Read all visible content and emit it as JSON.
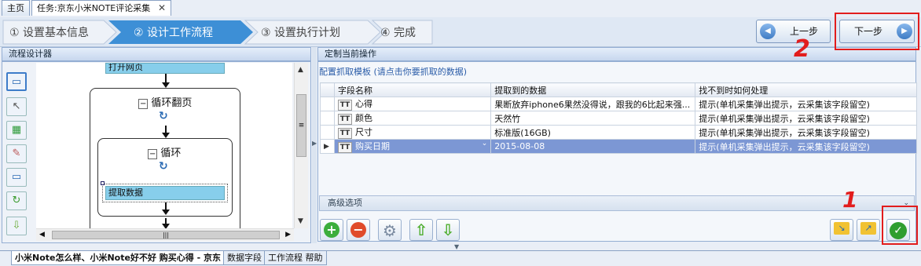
{
  "doc_tabs": [
    "主页",
    "任务:京东小米NOTE评论采集"
  ],
  "wizard": {
    "steps": [
      "① 设置基本信息",
      "② 设计工作流程",
      "③ 设置执行计划",
      "④ 完成"
    ],
    "prev_label": "上一步",
    "next_label": "下一步"
  },
  "left_panel": {
    "title": "流程设计器",
    "nodes": {
      "open_page": "打开网页",
      "loop_page": "循环翻页",
      "loop": "循环",
      "extract": "提取数据"
    }
  },
  "right_panel": {
    "title": "定制当前操作",
    "template_hint": "配置抓取模板 (请点击你要抓取的数据)",
    "columns": [
      "字段名称",
      "提取到的数据",
      "找不到时如何处理"
    ],
    "rows": [
      {
        "type": "TT",
        "name": "心得",
        "data": "果断放弃iphone6果然没得说，跟我的6比起来强...",
        "handling": "提示(单机采集弹出提示，云采集该字段留空)"
      },
      {
        "type": "TT",
        "name": "颜色",
        "data": "天然竹",
        "handling": "提示(单机采集弹出提示，云采集该字段留空)"
      },
      {
        "type": "TT",
        "name": "尺寸",
        "data": "标准版(16GB)",
        "handling": "提示(单机采集弹出提示，云采集该字段留空)"
      },
      {
        "type": "TT",
        "name": "购买日期",
        "data": "2015-08-08",
        "handling": "提示(单机采集弹出提示，云采集该字段留空)"
      }
    ],
    "advanced_label": "高级选项"
  },
  "bottom_tabs": [
    "小米Note怎么样、小米Note好不好 购买心得 - 京东",
    "数据字段",
    "工作流程 帮助"
  ],
  "annotations": [
    "2",
    "1"
  ],
  "colors": {
    "accent": "#3d8fd6",
    "selected_row": "#7c97d4",
    "highlight_red": "#e21d1d"
  }
}
